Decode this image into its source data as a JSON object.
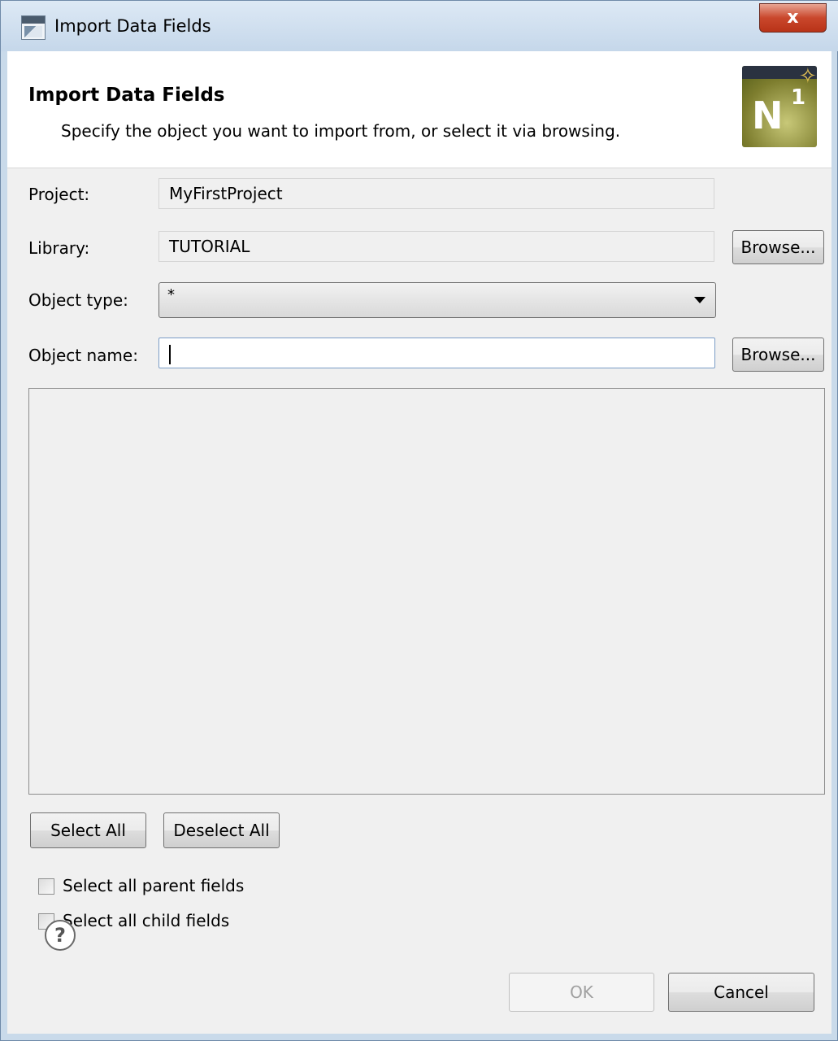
{
  "window": {
    "title": "Import Data Fields",
    "close_glyph": "x"
  },
  "header": {
    "title": "Import Data Fields",
    "description": "Specify the object you want to import from, or select it via browsing.",
    "logo_text": "N",
    "logo_sup": "1",
    "logo_star": "✧"
  },
  "form": {
    "project_label": "Project:",
    "project_value": "MyFirstProject",
    "library_label": "Library:",
    "library_value": "TUTORIAL",
    "library_browse": "Browse...",
    "object_type_label": "Object type:",
    "object_type_value": "*",
    "object_name_label": "Object name:",
    "object_name_value": "",
    "object_name_browse": "Browse..."
  },
  "actions": {
    "select_all": "Select All",
    "deselect_all": "Deselect All"
  },
  "options": {
    "parent_fields": "Select all parent fields",
    "child_fields": "Select all child fields"
  },
  "footer": {
    "help_glyph": "?",
    "ok": "OK",
    "cancel": "Cancel"
  },
  "colors": {
    "titlebar": "#c9daea",
    "close_button": "#c9472c",
    "dialog_background": "#f0f0f0"
  },
  "icons": [
    "app-icon",
    "close-icon",
    "dropdown-arrow-icon",
    "help-icon",
    "product-logo"
  ]
}
